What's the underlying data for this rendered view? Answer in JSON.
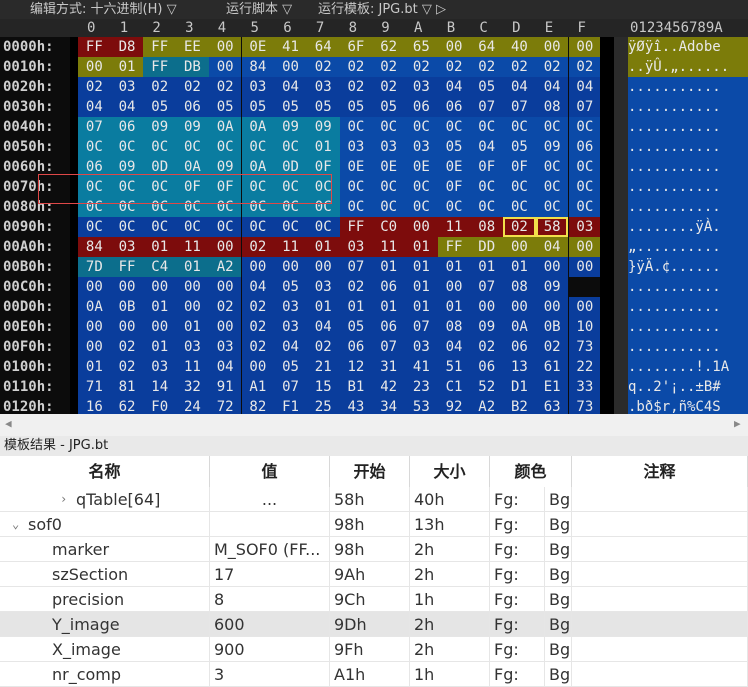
{
  "toolbar": {
    "edit_as": "编辑方式: 十六进制(H) ▽",
    "run_script": "运行脚本 ▽",
    "run_template": "运行模板: JPG.bt ▽ ▷"
  },
  "hex_header": {
    "cols": [
      "0",
      "1",
      "2",
      "3",
      "4",
      "5",
      "6",
      "7",
      "8",
      "9",
      "A",
      "B",
      "C",
      "D",
      "E",
      "F"
    ],
    "ascii": "0123456789A"
  },
  "hex_rows": [
    {
      "offset": "0000h:",
      "bytes": [
        "FF",
        "D8",
        "FF",
        "EE",
        "00",
        "0E",
        "41",
        "64",
        "6F",
        "62",
        "65",
        "00",
        "64",
        "40",
        "00",
        "00"
      ],
      "ascii": "ÿØÿî..Adobe"
    },
    {
      "offset": "0010h:",
      "bytes": [
        "00",
        "01",
        "FF",
        "DB",
        "00",
        "84",
        "00",
        "02",
        "02",
        "02",
        "02",
        "02",
        "02",
        "02",
        "02",
        "02"
      ],
      "ascii": "..ÿÛ.„......"
    },
    {
      "offset": "0020h:",
      "bytes": [
        "02",
        "03",
        "02",
        "02",
        "02",
        "03",
        "04",
        "03",
        "02",
        "02",
        "03",
        "04",
        "05",
        "04",
        "04",
        "04"
      ],
      "ascii": "..........."
    },
    {
      "offset": "0030h:",
      "bytes": [
        "04",
        "04",
        "05",
        "06",
        "05",
        "05",
        "05",
        "05",
        "05",
        "05",
        "06",
        "06",
        "07",
        "07",
        "08",
        "07"
      ],
      "ascii": "..........."
    },
    {
      "offset": "0040h:",
      "bytes": [
        "07",
        "06",
        "09",
        "09",
        "0A",
        "0A",
        "09",
        "09",
        "0C",
        "0C",
        "0C",
        "0C",
        "0C",
        "0C",
        "0C",
        "0C"
      ],
      "ascii": "..........."
    },
    {
      "offset": "0050h:",
      "bytes": [
        "0C",
        "0C",
        "0C",
        "0C",
        "0C",
        "0C",
        "0C",
        "01",
        "03",
        "03",
        "03",
        "05",
        "04",
        "05",
        "09",
        "06"
      ],
      "ascii": "..........."
    },
    {
      "offset": "0060h:",
      "bytes": [
        "06",
        "09",
        "0D",
        "0A",
        "09",
        "0A",
        "0D",
        "0F",
        "0E",
        "0E",
        "0E",
        "0E",
        "0F",
        "0F",
        "0C",
        "0C"
      ],
      "ascii": "..........."
    },
    {
      "offset": "0070h:",
      "bytes": [
        "0C",
        "0C",
        "0C",
        "0F",
        "0F",
        "0C",
        "0C",
        "0C",
        "0C",
        "0C",
        "0C",
        "0F",
        "0C",
        "0C",
        "0C",
        "0C"
      ],
      "ascii": "..........."
    },
    {
      "offset": "0080h:",
      "bytes": [
        "0C",
        "0C",
        "0C",
        "0C",
        "0C",
        "0C",
        "0C",
        "0C",
        "0C",
        "0C",
        "0C",
        "0C",
        "0C",
        "0C",
        "0C",
        "0C"
      ],
      "ascii": "..........."
    },
    {
      "offset": "0090h:",
      "bytes": [
        "0C",
        "0C",
        "0C",
        "0C",
        "0C",
        "0C",
        "0C",
        "0C",
        "FF",
        "C0",
        "00",
        "11",
        "08",
        "02",
        "58",
        "03"
      ],
      "ascii": "........ÿÀ."
    },
    {
      "offset": "00A0h:",
      "bytes": [
        "84",
        "03",
        "01",
        "11",
        "00",
        "02",
        "11",
        "01",
        "03",
        "11",
        "01",
        "FF",
        "DD",
        "00",
        "04",
        "00"
      ],
      "ascii": "„.........."
    },
    {
      "offset": "00B0h:",
      "bytes": [
        "7D",
        "FF",
        "C4",
        "01",
        "A2",
        "00",
        "00",
        "00",
        "07",
        "01",
        "01",
        "01",
        "01",
        "01",
        "00",
        "00"
      ],
      "ascii": "}ÿÄ.¢......"
    },
    {
      "offset": "00C0h:",
      "bytes": [
        "00",
        "00",
        "00",
        "00",
        "00",
        "04",
        "05",
        "03",
        "02",
        "06",
        "01",
        "00",
        "07",
        "08",
        "09"
      ],
      "ascii": "..........."
    },
    {
      "offset": "00D0h:",
      "bytes": [
        "0A",
        "0B",
        "01",
        "00",
        "02",
        "02",
        "03",
        "01",
        "01",
        "01",
        "01",
        "01",
        "00",
        "00",
        "00",
        "00"
      ],
      "ascii": "..........."
    },
    {
      "offset": "00E0h:",
      "bytes": [
        "00",
        "00",
        "00",
        "01",
        "00",
        "02",
        "03",
        "04",
        "05",
        "06",
        "07",
        "08",
        "09",
        "0A",
        "0B",
        "10"
      ],
      "ascii": "..........."
    },
    {
      "offset": "00F0h:",
      "bytes": [
        "00",
        "02",
        "01",
        "03",
        "03",
        "02",
        "04",
        "02",
        "06",
        "07",
        "03",
        "04",
        "02",
        "06",
        "02",
        "73"
      ],
      "ascii": "..........."
    },
    {
      "offset": "0100h:",
      "bytes": [
        "01",
        "02",
        "03",
        "11",
        "04",
        "00",
        "05",
        "21",
        "12",
        "31",
        "41",
        "51",
        "06",
        "13",
        "61",
        "22"
      ],
      "ascii": "........!.1A"
    },
    {
      "offset": "0110h:",
      "bytes": [
        "71",
        "81",
        "14",
        "32",
        "91",
        "A1",
        "07",
        "15",
        "B1",
        "42",
        "23",
        "C1",
        "52",
        "D1",
        "E1",
        "33"
      ],
      "ascii": "q..2'¡..±B#"
    },
    {
      "offset": "0120h:",
      "bytes": [
        "16",
        "62",
        "F0",
        "24",
        "72",
        "82",
        "F1",
        "25",
        "43",
        "34",
        "53",
        "92",
        "A2",
        "B2",
        "63",
        "73"
      ],
      "ascii": ".bð$r‚ñ%C4S"
    }
  ],
  "panel": {
    "title": "模板结果 - JPG.bt",
    "columns": [
      "名称",
      "值",
      "开始",
      "大小",
      "颜色",
      "注释"
    ],
    "rows": [
      {
        "name": "qTable[64]",
        "value": "...",
        "start": "58h",
        "size": "40h",
        "fg": "Fg:",
        "bg": "Bg:",
        "twisty": "›",
        "indent": 3
      },
      {
        "name": "sof0",
        "value": "",
        "start": "98h",
        "size": "13h",
        "fg": "Fg:",
        "bg": "Bg:",
        "twisty": "⌄",
        "indent": 1
      },
      {
        "name": "marker",
        "value": "M_SOF0 (FF...",
        "start": "98h",
        "size": "2h",
        "fg": "Fg:",
        "bg": "Bg:",
        "twisty": "",
        "indent": 2
      },
      {
        "name": "szSection",
        "value": "17",
        "start": "9Ah",
        "size": "2h",
        "fg": "Fg:",
        "bg": "Bg:",
        "twisty": "",
        "indent": 2
      },
      {
        "name": "precision",
        "value": "8",
        "start": "9Ch",
        "size": "1h",
        "fg": "Fg:",
        "bg": "Bg:",
        "twisty": "",
        "indent": 2
      },
      {
        "name": "Y_image",
        "value": "600",
        "start": "9Dh",
        "size": "2h",
        "fg": "Fg:",
        "bg": "Bg:",
        "twisty": "",
        "indent": 2
      },
      {
        "name": "X_image",
        "value": "900",
        "start": "9Fh",
        "size": "2h",
        "fg": "Fg:",
        "bg": "Bg:",
        "twisty": "",
        "indent": 2
      },
      {
        "name": "nr_comp",
        "value": "3",
        "start": "A1h",
        "size": "1h",
        "fg": "Fg:",
        "bg": "Bg:",
        "twisty": "",
        "indent": 2
      }
    ]
  },
  "colors": {
    "marker": "#7d0c0c",
    "len_olive": "#7c7c0a",
    "len_teal": "#0c6e8c",
    "qtable": "#0b4aa8",
    "qtable_alt": "#0a7ca0",
    "dark_blue": "#0a3d9c"
  }
}
